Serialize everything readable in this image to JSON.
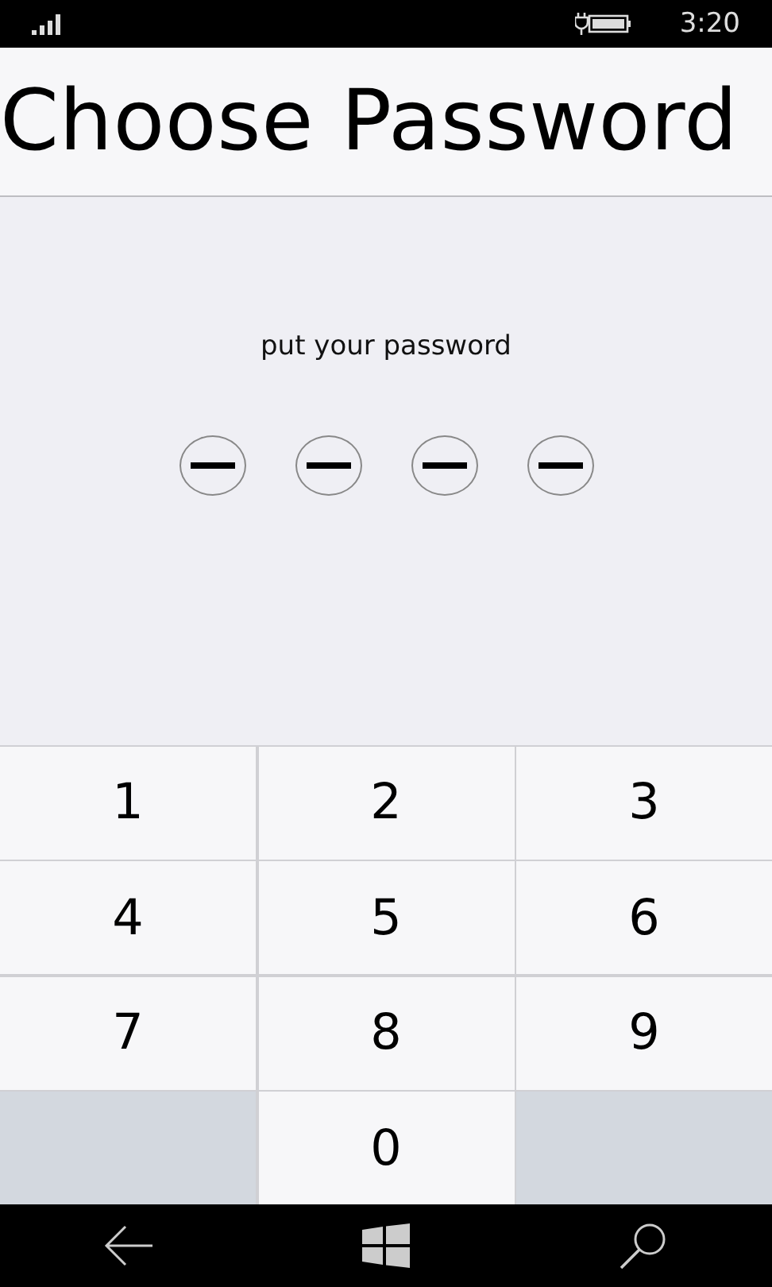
{
  "status_bar": {
    "time": "3:20",
    "charging": true
  },
  "header": {
    "title": "Choose Password"
  },
  "prompt": "put your password",
  "pin_dots": [
    {
      "filled": false
    },
    {
      "filled": false
    },
    {
      "filled": false
    },
    {
      "filled": false
    }
  ],
  "keypad": [
    {
      "kind": "digit",
      "label": "1"
    },
    {
      "kind": "digit",
      "label": "2"
    },
    {
      "kind": "digit",
      "label": "3"
    },
    {
      "kind": "digit",
      "label": "4"
    },
    {
      "kind": "digit",
      "label": "5"
    },
    {
      "kind": "digit",
      "label": "6"
    },
    {
      "kind": "digit",
      "label": "7"
    },
    {
      "kind": "digit",
      "label": "8"
    },
    {
      "kind": "digit",
      "label": "9"
    },
    {
      "kind": "blank"
    },
    {
      "kind": "digit",
      "label": "0"
    },
    {
      "kind": "blank"
    }
  ]
}
